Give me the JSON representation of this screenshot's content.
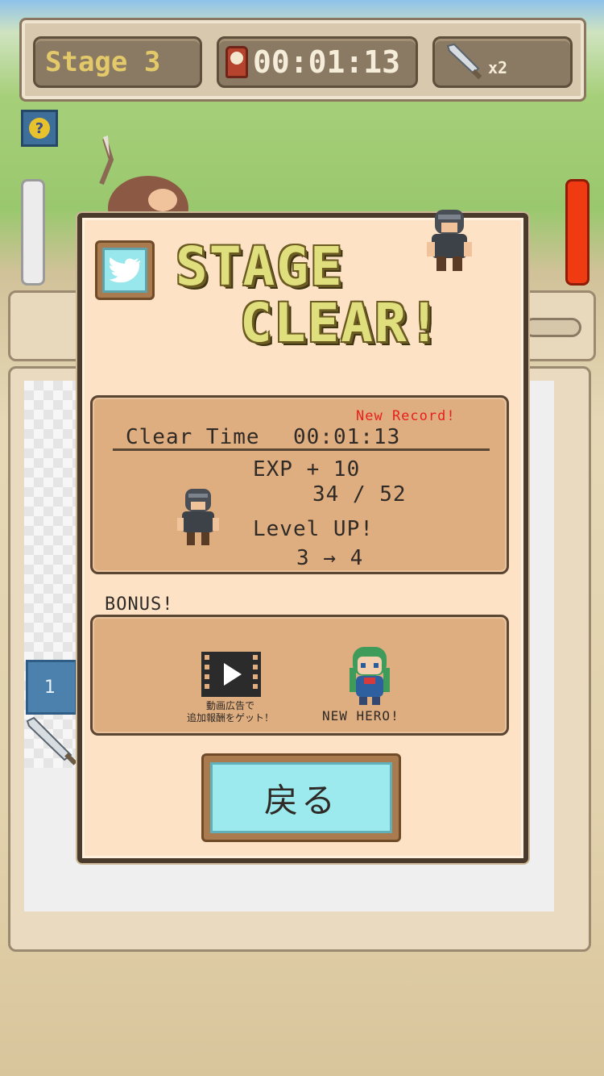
{
  "hud": {
    "stage_label": "Stage 3",
    "timer": "00:01:13",
    "sword_multiplier": "x2"
  },
  "modal": {
    "title_line1": "STAGE",
    "title_line2": "CLEAR!",
    "new_record": "New Record!",
    "clear_time_label": "Clear Time",
    "clear_time_value": "00:01:13",
    "exp_line": "EXP + 10",
    "exp_progress": "34 / 52",
    "level_up": "Level UP!",
    "level_change": "3 → 4",
    "bonus_label": "BONUS!",
    "video_caption_line1": "動画広告で",
    "video_caption_line2": "追加報酬をゲット！",
    "new_hero_label": "NEW HERO!",
    "back_button_label": "戻る"
  },
  "board": {
    "tile_number": "1"
  },
  "icons": [
    "clock-icon",
    "sword-icon",
    "help-icon",
    "twitter-icon",
    "video-play-icon",
    "knight-sprite",
    "hero-sprite",
    "monkey-enemy-sprite"
  ],
  "colors": {
    "title_fill": "#dfe07d",
    "new_record": "#e8201b",
    "button_face": "#9ce9ee",
    "hp_bar": "#ef3a12"
  }
}
